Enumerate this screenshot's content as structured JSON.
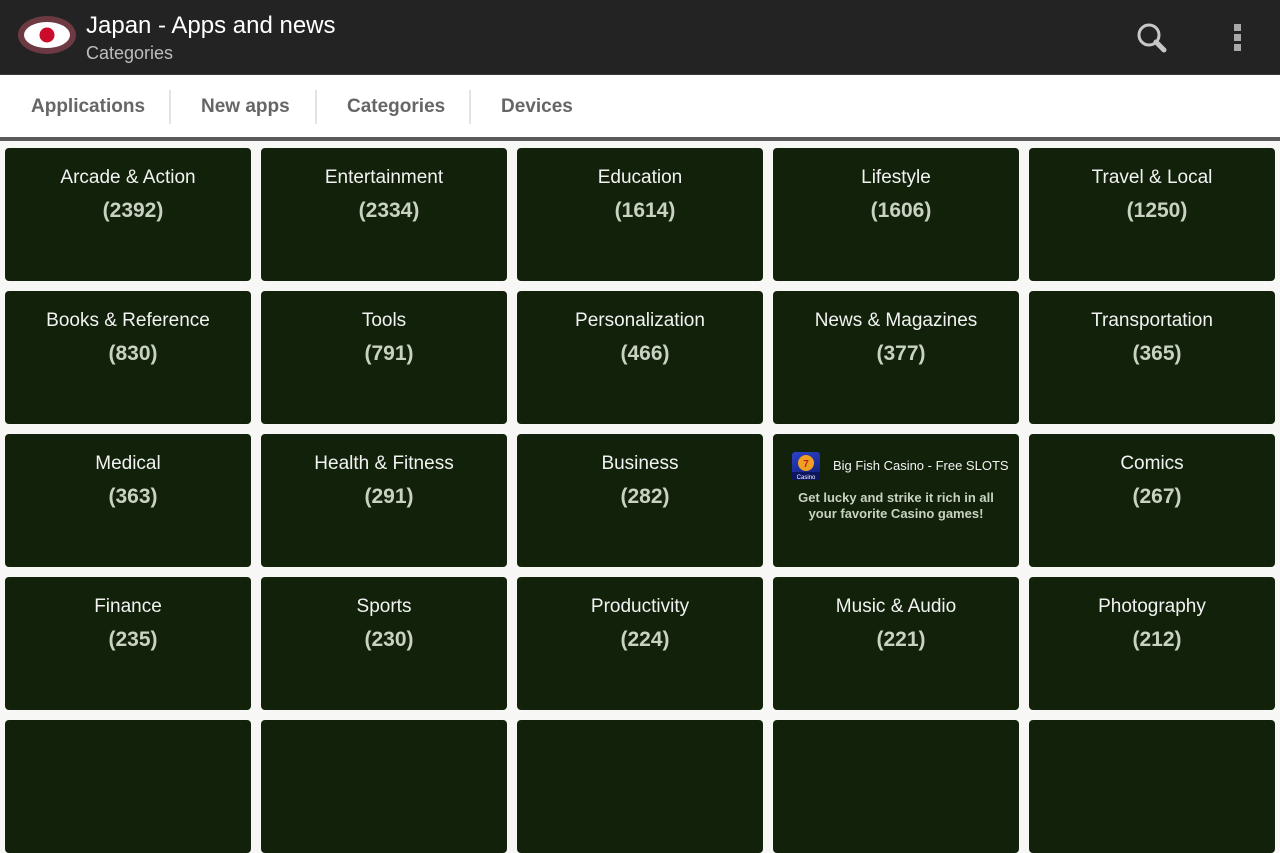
{
  "app": {
    "title": "Japan - Apps and news",
    "subtitle": "Categories",
    "logo_icon": "japan-flag-eye-icon",
    "search_icon": "search-icon",
    "menu_icon": "overflow-menu-icon"
  },
  "tabs": [
    {
      "label": "Applications"
    },
    {
      "label": "New apps"
    },
    {
      "label": "Categories",
      "selected": true
    },
    {
      "label": "Devices"
    }
  ],
  "colors": {
    "tile_bg": "#11210a",
    "actionbar_bg": "#232323",
    "flag_red": "#cc0b2b"
  },
  "categories": [
    {
      "name": "Arcade & Action",
      "count": "(2392)"
    },
    {
      "name": "Entertainment",
      "count": "(2334)"
    },
    {
      "name": "Education",
      "count": "(1614)"
    },
    {
      "name": "Lifestyle",
      "count": "(1606)"
    },
    {
      "name": "Travel & Local",
      "count": "(1250)"
    },
    {
      "name": "Books & Reference",
      "count": "(830)"
    },
    {
      "name": "Tools",
      "count": "(791)"
    },
    {
      "name": "Personalization",
      "count": "(466)"
    },
    {
      "name": "News & Magazines",
      "count": "(377)"
    },
    {
      "name": "Transportation",
      "count": "(365)"
    },
    {
      "name": "Medical",
      "count": "(363)"
    },
    {
      "name": "Health & Fitness",
      "count": "(291)"
    },
    {
      "name": "Business",
      "count": "(282)"
    },
    {
      "name": "Comics",
      "count": "(267)"
    },
    {
      "name": "Finance",
      "count": "(235)"
    },
    {
      "name": "Sports",
      "count": "(230)"
    },
    {
      "name": "Productivity",
      "count": "(224)"
    },
    {
      "name": "Music & Audio",
      "count": "(221)"
    },
    {
      "name": "Photography",
      "count": "(212)"
    }
  ],
  "ad": {
    "title": "Big Fish Casino - Free SLOTS",
    "description": "Get lucky and strike it rich in all your favorite Casino games!",
    "icon_label": "Casino",
    "icon": "casino-app-icon"
  }
}
